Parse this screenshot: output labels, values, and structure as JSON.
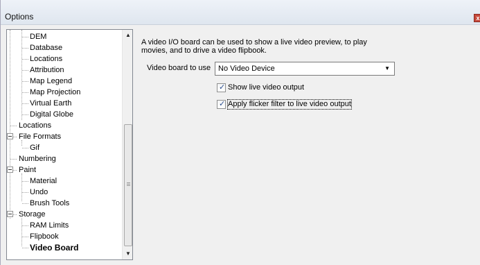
{
  "window": {
    "title": "Options",
    "close_glyph": "x"
  },
  "tree": {
    "items": [
      {
        "label": "DEM",
        "level": 2
      },
      {
        "label": "Database",
        "level": 2
      },
      {
        "label": "Locations",
        "level": 2
      },
      {
        "label": "Attribution",
        "level": 2
      },
      {
        "label": "Map Legend",
        "level": 2
      },
      {
        "label": "Map Projection",
        "level": 2
      },
      {
        "label": "Virtual Earth",
        "level": 2
      },
      {
        "label": "Digital Globe",
        "level": 2
      },
      {
        "label": "Locations",
        "level": 1
      },
      {
        "label": "File Formats",
        "level": 1,
        "expanded": true
      },
      {
        "label": "Gif",
        "level": 2
      },
      {
        "label": "Numbering",
        "level": 1
      },
      {
        "label": "Paint",
        "level": 1,
        "expanded": true
      },
      {
        "label": "Material",
        "level": 2
      },
      {
        "label": "Undo",
        "level": 2
      },
      {
        "label": "Brush Tools",
        "level": 2
      },
      {
        "label": "Storage",
        "level": 1,
        "expanded": true
      },
      {
        "label": "RAM Limits",
        "level": 2
      },
      {
        "label": "Flipbook",
        "level": 2
      },
      {
        "label": "Video Board",
        "level": 2,
        "selected": true
      }
    ],
    "scrollbar": {
      "up_icon": "▲",
      "down_icon": "▼"
    }
  },
  "panel": {
    "description_line1": "A video I/O board can be used to show a live video preview, to play",
    "description_line2": "movies, and to drive a video flipbook.",
    "video_board_label": "Video board to use",
    "video_board_value": "No Video Device",
    "dropdown_icon": "▼",
    "show_live_label": "Show live video output",
    "show_live_checked": true,
    "flicker_label": "Apply flicker filter to live video output",
    "flicker_checked": true,
    "check_glyph": "✓"
  },
  "colors": {
    "selection_text": "#000000",
    "checkmark": "#2a4d8f",
    "close_button": "#c74a3c"
  }
}
